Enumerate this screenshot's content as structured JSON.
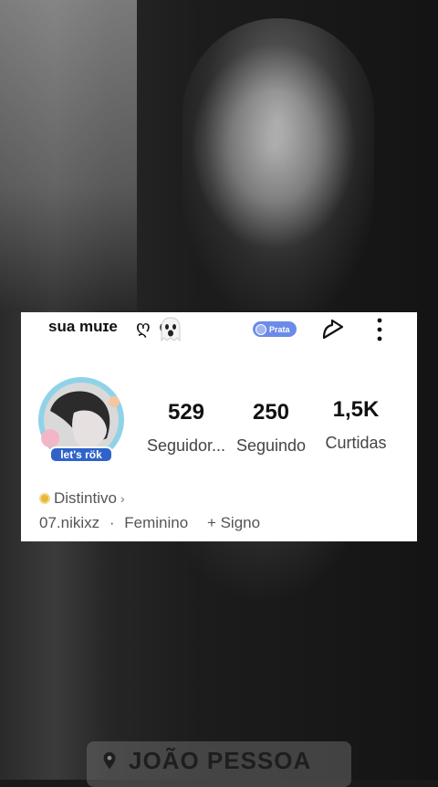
{
  "profile": {
    "username": "sua muɪe",
    "decoration": "ღ  ღ",
    "badge_label": "Prata",
    "avatar_text": "let's rök"
  },
  "stats": [
    {
      "value": "529",
      "label": "Seguidor..."
    },
    {
      "value": "250",
      "label": "Seguindo"
    },
    {
      "value": "1,5K",
      "label": "Curtidas"
    }
  ],
  "distintivo": {
    "label": "Distintivo",
    "chevron": "›"
  },
  "meta": {
    "handle": "07.nikixz",
    "separator": "·",
    "gender": "Feminino",
    "sign": "+ Signo"
  },
  "location": {
    "text": "JOÃO PESSOA"
  },
  "icons": {
    "share": "share-icon",
    "more": "more-vertical-icon",
    "ghost": "ghost-emoji-icon",
    "pin": "location-pin-icon"
  },
  "colors": {
    "badge": "#6b8be8",
    "card_bg": "#ffffff",
    "badge_dot": "#e8b63a"
  }
}
